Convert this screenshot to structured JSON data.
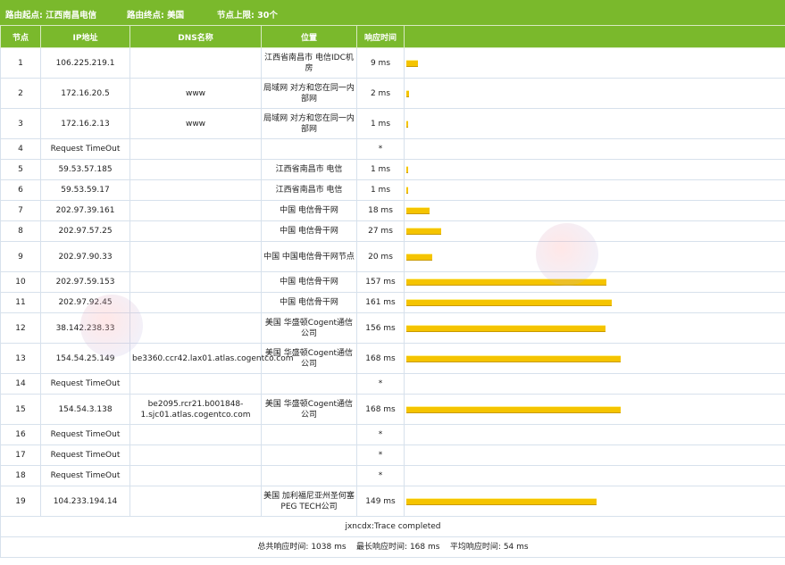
{
  "header": {
    "start_label": "路由起点:",
    "start_value": "江西南昌电信",
    "end_label": "路由终点:",
    "end_value": "美国",
    "limit_label": "节点上限:",
    "limit_value": "30个"
  },
  "columns": {
    "node": "节点",
    "ip": "IP地址",
    "dns": "DNS名称",
    "location": "位置",
    "response": "响应时间"
  },
  "hops": [
    {
      "node": "1",
      "ip": "106.225.219.1",
      "dns": "",
      "location": "江西省南昌市 电信IDC机房",
      "time": "9 ms",
      "ms": 9,
      "tall": true
    },
    {
      "node": "2",
      "ip": "172.16.20.5",
      "dns": "www",
      "location": "局域网 对方和您在同一内部网",
      "time": "2 ms",
      "ms": 2,
      "tall": true
    },
    {
      "node": "3",
      "ip": "172.16.2.13",
      "dns": "www",
      "location": "局域网 对方和您在同一内部网",
      "time": "1 ms",
      "ms": 1,
      "tall": true
    },
    {
      "node": "4",
      "ip": "Request TimeOut",
      "dns": "",
      "location": "",
      "time": "*",
      "ms": 0,
      "tall": false
    },
    {
      "node": "5",
      "ip": "59.53.57.185",
      "dns": "",
      "location": "江西省南昌市 电信",
      "time": "1 ms",
      "ms": 1,
      "tall": false
    },
    {
      "node": "6",
      "ip": "59.53.59.17",
      "dns": "",
      "location": "江西省南昌市 电信",
      "time": "1 ms",
      "ms": 1,
      "tall": false
    },
    {
      "node": "7",
      "ip": "202.97.39.161",
      "dns": "",
      "location": "中国 电信骨干网",
      "time": "18 ms",
      "ms": 18,
      "tall": false
    },
    {
      "node": "8",
      "ip": "202.97.57.25",
      "dns": "",
      "location": "中国 电信骨干网",
      "time": "27 ms",
      "ms": 27,
      "tall": false
    },
    {
      "node": "9",
      "ip": "202.97.90.33",
      "dns": "",
      "location": "中国 中国电信骨干网节点",
      "time": "20 ms",
      "ms": 20,
      "tall": true
    },
    {
      "node": "10",
      "ip": "202.97.59.153",
      "dns": "",
      "location": "中国 电信骨干网",
      "time": "157 ms",
      "ms": 157,
      "tall": false
    },
    {
      "node": "11",
      "ip": "202.97.92.45",
      "dns": "",
      "location": "中国 电信骨干网",
      "time": "161 ms",
      "ms": 161,
      "tall": false
    },
    {
      "node": "12",
      "ip": "38.142.238.33",
      "dns": "",
      "location": "美国 华盛顿Cogent通信公司",
      "time": "156 ms",
      "ms": 156,
      "tall": true
    },
    {
      "node": "13",
      "ip": "154.54.25.149",
      "dns": "be3360.ccr42.lax01.atlas.cogentco.com",
      "location": "美国 华盛顿Cogent通信公司",
      "time": "168 ms",
      "ms": 168,
      "tall": true
    },
    {
      "node": "14",
      "ip": "Request TimeOut",
      "dns": "",
      "location": "",
      "time": "*",
      "ms": 0,
      "tall": false
    },
    {
      "node": "15",
      "ip": "154.54.3.138",
      "dns": "be2095.rcr21.b001848-1.sjc01.atlas.cogentco.com",
      "location": "美国 华盛顿Cogent通信公司",
      "time": "168 ms",
      "ms": 168,
      "tall": true
    },
    {
      "node": "16",
      "ip": "Request TimeOut",
      "dns": "",
      "location": "",
      "time": "*",
      "ms": 0,
      "tall": false
    },
    {
      "node": "17",
      "ip": "Request TimeOut",
      "dns": "",
      "location": "",
      "time": "*",
      "ms": 0,
      "tall": false
    },
    {
      "node": "18",
      "ip": "Request TimeOut",
      "dns": "",
      "location": "",
      "time": "*",
      "ms": 0,
      "tall": false
    },
    {
      "node": "19",
      "ip": "104.233.194.14",
      "dns": "",
      "location": "美国 加利福尼亚州圣何塞PEG TECH公司",
      "time": "149 ms",
      "ms": 149,
      "tall": true
    }
  ],
  "footer": {
    "completed": "jxncdx:Trace completed",
    "total_label": "总共响应时间:",
    "total_value": "1038 ms",
    "max_label": "最长响应时间:",
    "max_value": "168 ms",
    "avg_label": "平均响应时间:",
    "avg_value": "54 ms"
  },
  "colors": {
    "header_green": "#7ab92c",
    "bar_yellow": "#f5c400"
  }
}
